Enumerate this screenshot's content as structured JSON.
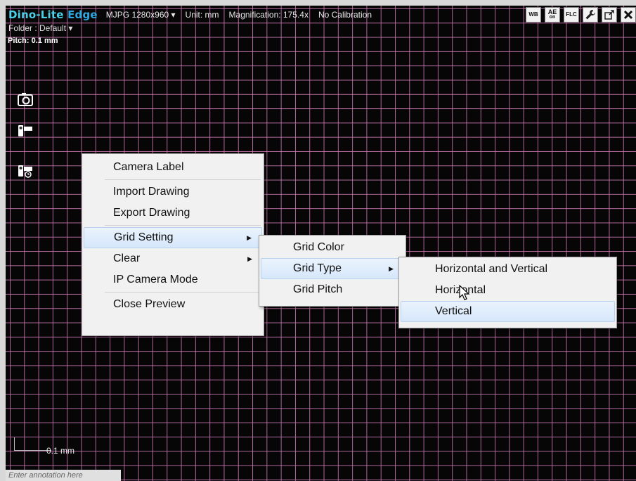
{
  "app": {
    "title_part1": "Dino-Lite",
    "title_part2": " Edge",
    "resolution": "MJPG 1280x960",
    "unit": "Unit: mm",
    "magnification": "Magnification:  175.4x",
    "calibration": "No Calibration",
    "folder": "Folder : Default",
    "pitch": "Pitch: 0.1 mm",
    "scale_label": "0.1 mm",
    "annotation_placeholder": "Enter annotation here"
  },
  "toolbar": {
    "wb_label": "WB",
    "ae_label": "AE",
    "ae_sub": "on",
    "flc_label": "FLC"
  },
  "context_menu": {
    "items": [
      "Camera Label",
      "Import Drawing",
      "Export Drawing",
      "Grid Setting",
      "Clear",
      "IP Camera Mode",
      "Close Preview"
    ]
  },
  "grid_submenu": {
    "items": [
      "Grid Color",
      "Grid Type",
      "Grid Pitch"
    ]
  },
  "gridtype_submenu": {
    "items": [
      "Horizontal and Vertical",
      "Horizontal",
      "Vertical"
    ]
  },
  "colors": {
    "grid": "#cd78b4",
    "title_accent": "#4ad0e8",
    "menu_highlight": "#d6e7fb"
  }
}
